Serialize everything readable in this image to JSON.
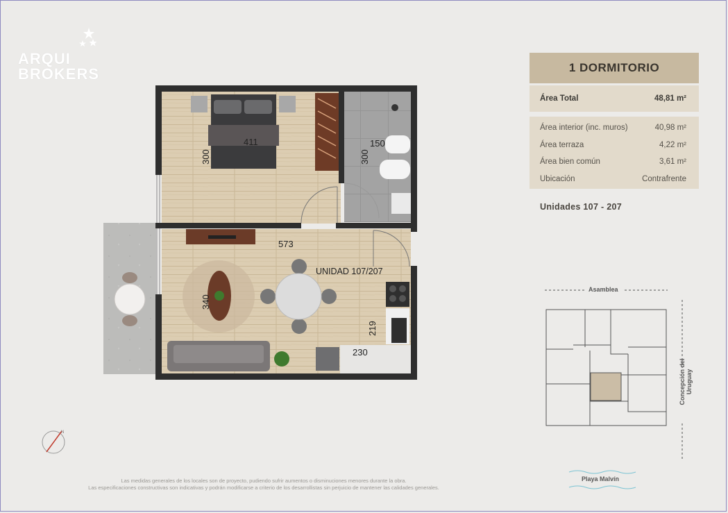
{
  "logo": {
    "line1": "ARQUI",
    "line2": "BROKERS"
  },
  "unit_card": {
    "title": "1 DORMITORIO",
    "total_label": "Área Total",
    "total_value": "48,81 m²",
    "rows": [
      {
        "label": "Área interior (inc. muros)",
        "value": "40,98 m²"
      },
      {
        "label": "Área terraza",
        "value": "4,22 m²"
      },
      {
        "label": "Área bien común",
        "value": "3,61 m²"
      },
      {
        "label": "Ubicación",
        "value": "Contrafrente"
      }
    ],
    "units_label": "Unidades  107 - 207"
  },
  "plan": {
    "unit_label": "UNIDAD 107/207",
    "dims": {
      "bedroom_w": "411",
      "bedroom_h": "300",
      "bath_w": "150",
      "bath_h": "300",
      "living_w": "573",
      "living_h": "340",
      "kitchen_h": "219",
      "kitchen_w": "230"
    }
  },
  "site_map": {
    "top_street": "Asamblea",
    "side_street": "Concepción del Uruguay",
    "bottom_label": "Playa Malvín"
  },
  "disclaimer": {
    "line1": "Las medidas generales de los locales son de proyecto, pudiendo sufrir aumentos o disminuciones menores durante la obra.",
    "line2": "Las especificaciones constructivas son indicativas y podrán modificarse a criterio de los desarrollistas sin perjuicio de mantener las calidades generales."
  },
  "colors": {
    "wood": "#d9c9ad",
    "wall": "#2e2e2e",
    "tile": "#9e9e9e",
    "terrace": "#bdbdbb",
    "card": "#c7b9a0",
    "card_light": "#e2dacb"
  }
}
